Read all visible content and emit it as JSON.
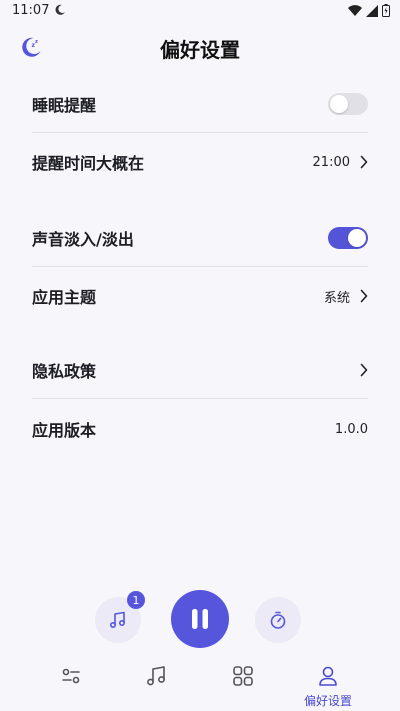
{
  "status_bar": {
    "time": "11:07"
  },
  "header": {
    "title": "偏好设置"
  },
  "settings": {
    "sleep_reminder": {
      "label": "睡眠提醒",
      "enabled": false
    },
    "reminder_time": {
      "label": "提醒时间大概在",
      "value": "21:00"
    },
    "fade": {
      "label": "声音淡入/淡出",
      "enabled": true
    },
    "theme": {
      "label": "应用主题",
      "value": "系统"
    },
    "privacy": {
      "label": "隐私政策"
    },
    "version": {
      "label": "应用版本",
      "value": "1.0.0"
    }
  },
  "player": {
    "queue_badge": "1"
  },
  "bottom_nav": {
    "items": [
      {
        "icon": "sliders-icon",
        "label": ""
      },
      {
        "icon": "music-note-icon",
        "label": ""
      },
      {
        "icon": "grid-icon",
        "label": ""
      },
      {
        "icon": "person-icon",
        "label": "偏好设置",
        "active": true
      }
    ]
  },
  "colors": {
    "accent": "#5656dd",
    "background": "#f7f6fb",
    "toggle_off": "#e1e0e7"
  }
}
